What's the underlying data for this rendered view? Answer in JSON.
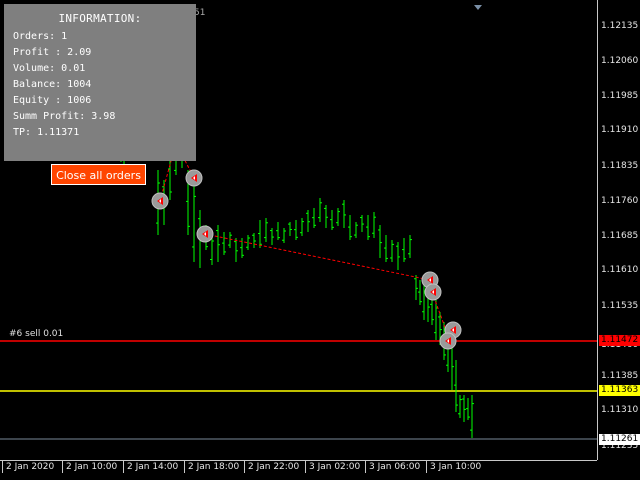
{
  "info_panel": {
    "title": "INFORMATION:",
    "lines": [
      "Orders: 1",
      "Profit : 2.09",
      "Volume: 0.01",
      "Balance: 1004",
      "Equity : 1006",
      "Summ Profit: 3.98",
      "TP: 1.11371"
    ]
  },
  "buttons": {
    "close_all": "Close all orders"
  },
  "order_label": "#6 sell 0.01",
  "top_fragment": "51",
  "price_axis": {
    "labels": [
      "1.12135",
      "1.12060",
      "1.11985",
      "1.11910",
      "1.11835",
      "1.11760",
      "1.11685",
      "1.11610",
      "1.11535",
      "1.11460",
      "1.11385",
      "1.11310",
      "1.11235"
    ],
    "badges": [
      {
        "text": "1.11472",
        "bg": "#ff0000",
        "fg": "#000000"
      },
      {
        "text": "1.11363",
        "bg": "#ffff00",
        "fg": "#000000"
      },
      {
        "text": "1.11261",
        "bg": "#ffffff",
        "fg": "#000000"
      }
    ]
  },
  "time_axis": {
    "labels": [
      "2 Jan 2020",
      "2 Jan 10:00",
      "2 Jan 14:00",
      "2 Jan 18:00",
      "2 Jan 22:00",
      "3 Jan 02:00",
      "3 Jan 06:00",
      "3 Jan 10:00"
    ]
  },
  "colors": {
    "background": "#000000",
    "bars": "#00ff00",
    "sell_line": "#ff0000",
    "tp_line": "#ffff00",
    "bid_line": "#778899",
    "panel": "#7f7f7f",
    "button": "#ff4500"
  },
  "icons": [
    "trade-arrow-icon",
    "trade-marker-icon",
    "scroll-marker-icon"
  ]
}
